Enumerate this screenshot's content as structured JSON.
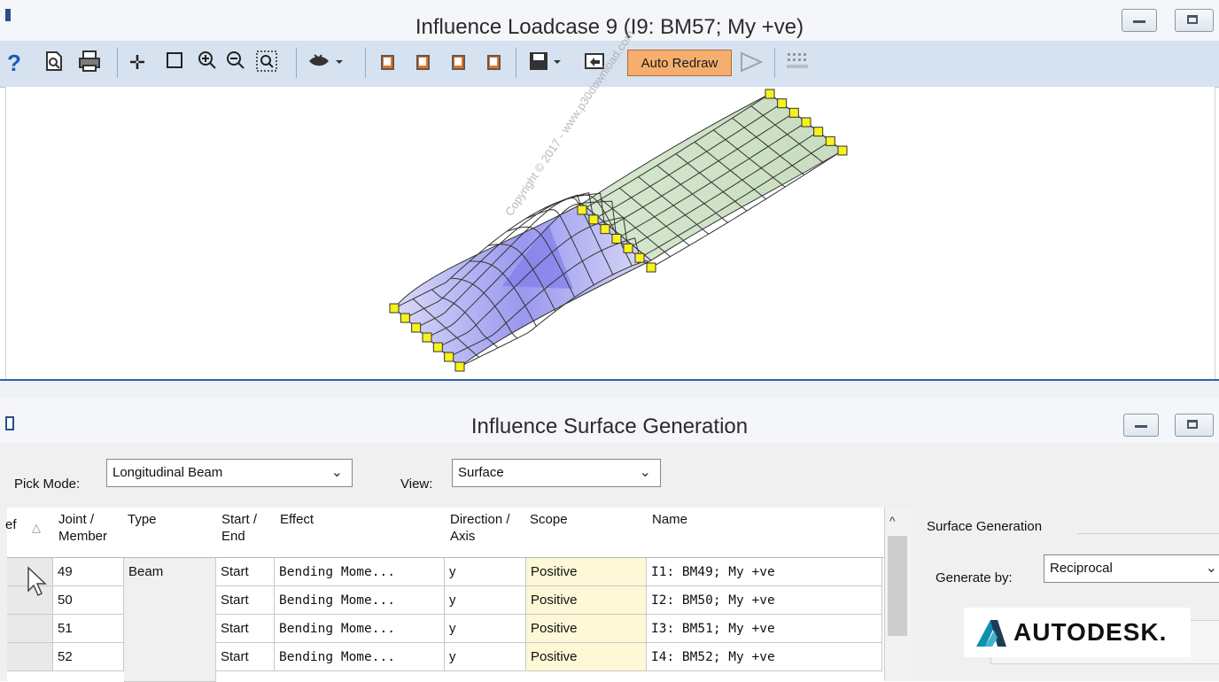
{
  "top_window": {
    "title": "Influence Loadcase 9 (I9: BM57; My +ve)",
    "toolbar": {
      "help_icon": "help-icon",
      "auto_redraw_label": "Auto Redraw"
    }
  },
  "bottom_window": {
    "title": "Influence Surface Generation",
    "pick_mode": {
      "label": "Pick Mode:",
      "value": "Longitudinal Beam"
    },
    "view": {
      "label": "View:",
      "value": "Surface"
    },
    "table": {
      "columns": [
        "ef",
        "Joint / Member",
        "Type",
        "Start / End",
        "Effect",
        "Direction / Axis",
        "Scope",
        "Name"
      ],
      "rows": [
        {
          "joint": "49",
          "type": "Beam",
          "start_end": "Start",
          "effect": "Bending Mome...",
          "direction": "y",
          "scope": "Positive",
          "name": "I1: BM49; My +ve"
        },
        {
          "joint": "50",
          "type": "",
          "start_end": "Start",
          "effect": "Bending Mome...",
          "direction": "y",
          "scope": "Positive",
          "name": "I2: BM50; My +ve"
        },
        {
          "joint": "51",
          "type": "",
          "start_end": "Start",
          "effect": "Bending Mome...",
          "direction": "y",
          "scope": "Positive",
          "name": "I3: BM51; My +ve"
        },
        {
          "joint": "52",
          "type": "",
          "start_end": "Start",
          "effect": "Bending Mome...",
          "direction": "y",
          "scope": "Positive",
          "name": "I4: BM52; My +ve"
        }
      ]
    },
    "surface_generation": {
      "group_label": "Surface Generation",
      "generate_by_label": "Generate by:",
      "generate_by_value": "Reciprocal"
    }
  },
  "watermark": "Copyright © 2017 - www.p30download.com",
  "branding": {
    "logo_text": "AUTODESK."
  },
  "colors": {
    "accent": "#2e63a8",
    "auto_redraw": "#f6ae6e",
    "positive_cell": "#fff8d6",
    "mesh_near": "#8c8cf0",
    "mesh_far": "#cfe2c4"
  }
}
